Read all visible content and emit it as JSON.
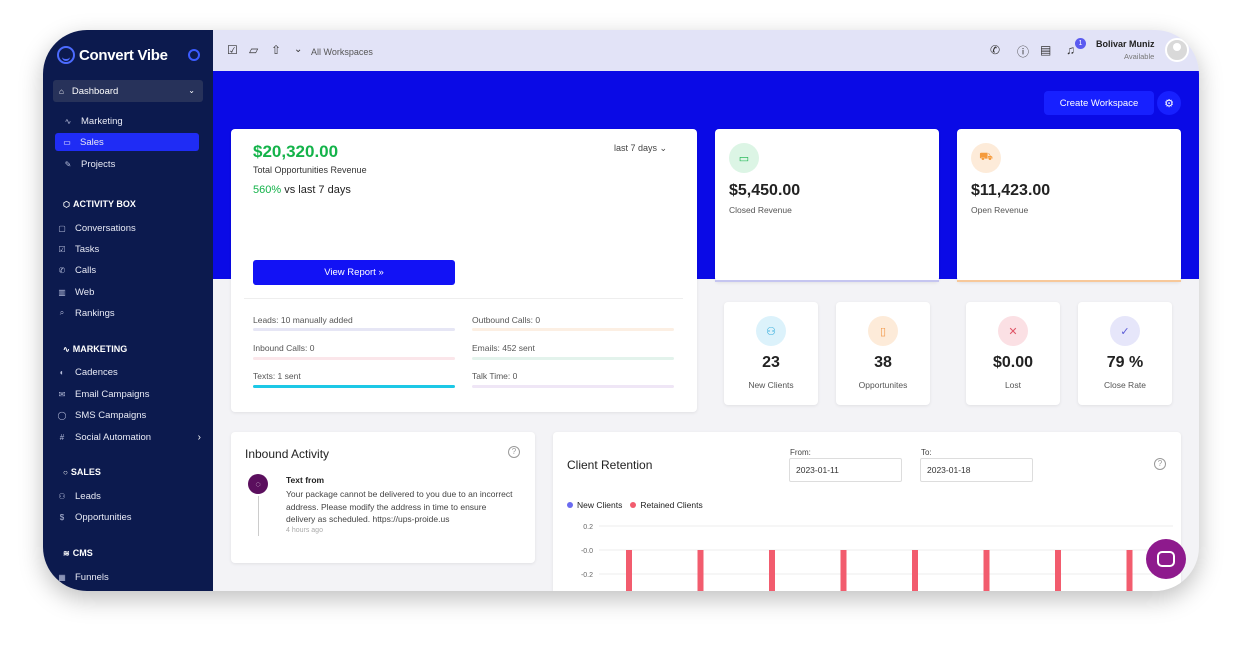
{
  "brand": {
    "name": "Convert Vibe"
  },
  "sidebar": {
    "dashboard": "Dashboard",
    "sub_items": [
      "Marketing",
      "Sales",
      "Projects"
    ],
    "active": "Sales",
    "sections": {
      "activity_box": {
        "title": "ACTIVITY BOX",
        "items": [
          "Conversations",
          "Tasks",
          "Calls",
          "Web",
          "Rankings"
        ]
      },
      "marketing": {
        "title": "MARKETING",
        "items": [
          "Cadences",
          "Email Campaigns",
          "SMS Campaigns",
          "Social Automation"
        ]
      },
      "sales": {
        "title": "SALES",
        "items": [
          "Leads",
          "Opportunities"
        ]
      },
      "cms": {
        "title": "CMS",
        "items": [
          "Funnels"
        ]
      }
    }
  },
  "topbar": {
    "workspace": "All Workspaces",
    "notifications": "1",
    "user": {
      "name": "Bolivar Muniz",
      "status": "Available"
    }
  },
  "banner": {
    "create_button": "Create Workspace"
  },
  "revenue": {
    "total": "$20,320.00",
    "label": "Total Opportunities Revenue",
    "change_pct": "560%",
    "change_text": "vs last 7 days",
    "range": "last 7 days",
    "view_report": "View Report »",
    "stats": [
      {
        "label": "Leads: 10 manually added",
        "color": "#e6e6f5"
      },
      {
        "label": "Outbound Calls: 0",
        "color": "#fcefe3"
      },
      {
        "label": "Inbound Calls: 0",
        "color": "#fbe6ea"
      },
      {
        "label": "Emails: 452 sent",
        "color": "#e3f3ec"
      },
      {
        "label": "Texts: 1 sent",
        "color": "#1cc8e6"
      },
      {
        "label": "Talk Time: 0",
        "color": "#efe6f6"
      }
    ]
  },
  "closed": {
    "value": "$5,450.00",
    "label": "Closed Revenue",
    "accent": "#14b34a"
  },
  "open": {
    "value": "$11,423.00",
    "label": "Open Revenue",
    "accent": "#f59a3b"
  },
  "kpis": [
    {
      "value": "23",
      "label": "New Clients",
      "icon": "users-icon",
      "color": "#22a6d9",
      "bg": "#dcf2fb"
    },
    {
      "value": "38",
      "label": "Opportunites",
      "icon": "document-icon",
      "color": "#f2994a",
      "bg": "#fdebd9"
    },
    {
      "value": "$0.00",
      "label": "Lost",
      "icon": "user-x-icon",
      "color": "#e05567",
      "bg": "#fbe0e4"
    },
    {
      "value": "79 %",
      "label": "Close Rate",
      "icon": "check-icon",
      "color": "#5b5bd6",
      "bg": "#e6e6fa"
    }
  ],
  "inbound": {
    "title": "Inbound Activity",
    "message": {
      "title": "Text from",
      "body": "Your package cannot be delivered to you due to an incorrect address. Please modify the address in time to ensure delivery as scheduled. https://ups-proide.us",
      "time": "4 hours ago"
    }
  },
  "retention": {
    "title": "Client Retention",
    "from_label": "From:",
    "from_value": "2023-01-11",
    "to_label": "To:",
    "to_value": "2023-01-18"
  },
  "chart_data": {
    "type": "bar",
    "series": [
      {
        "name": "New Clients",
        "color": "#6b6bf0",
        "values": []
      },
      {
        "name": "Retained Clients",
        "color": "#f25c6e",
        "values": []
      }
    ],
    "y_ticks": [
      "0.2",
      "-0.0",
      "-0.2"
    ],
    "bars_visible": 8
  }
}
